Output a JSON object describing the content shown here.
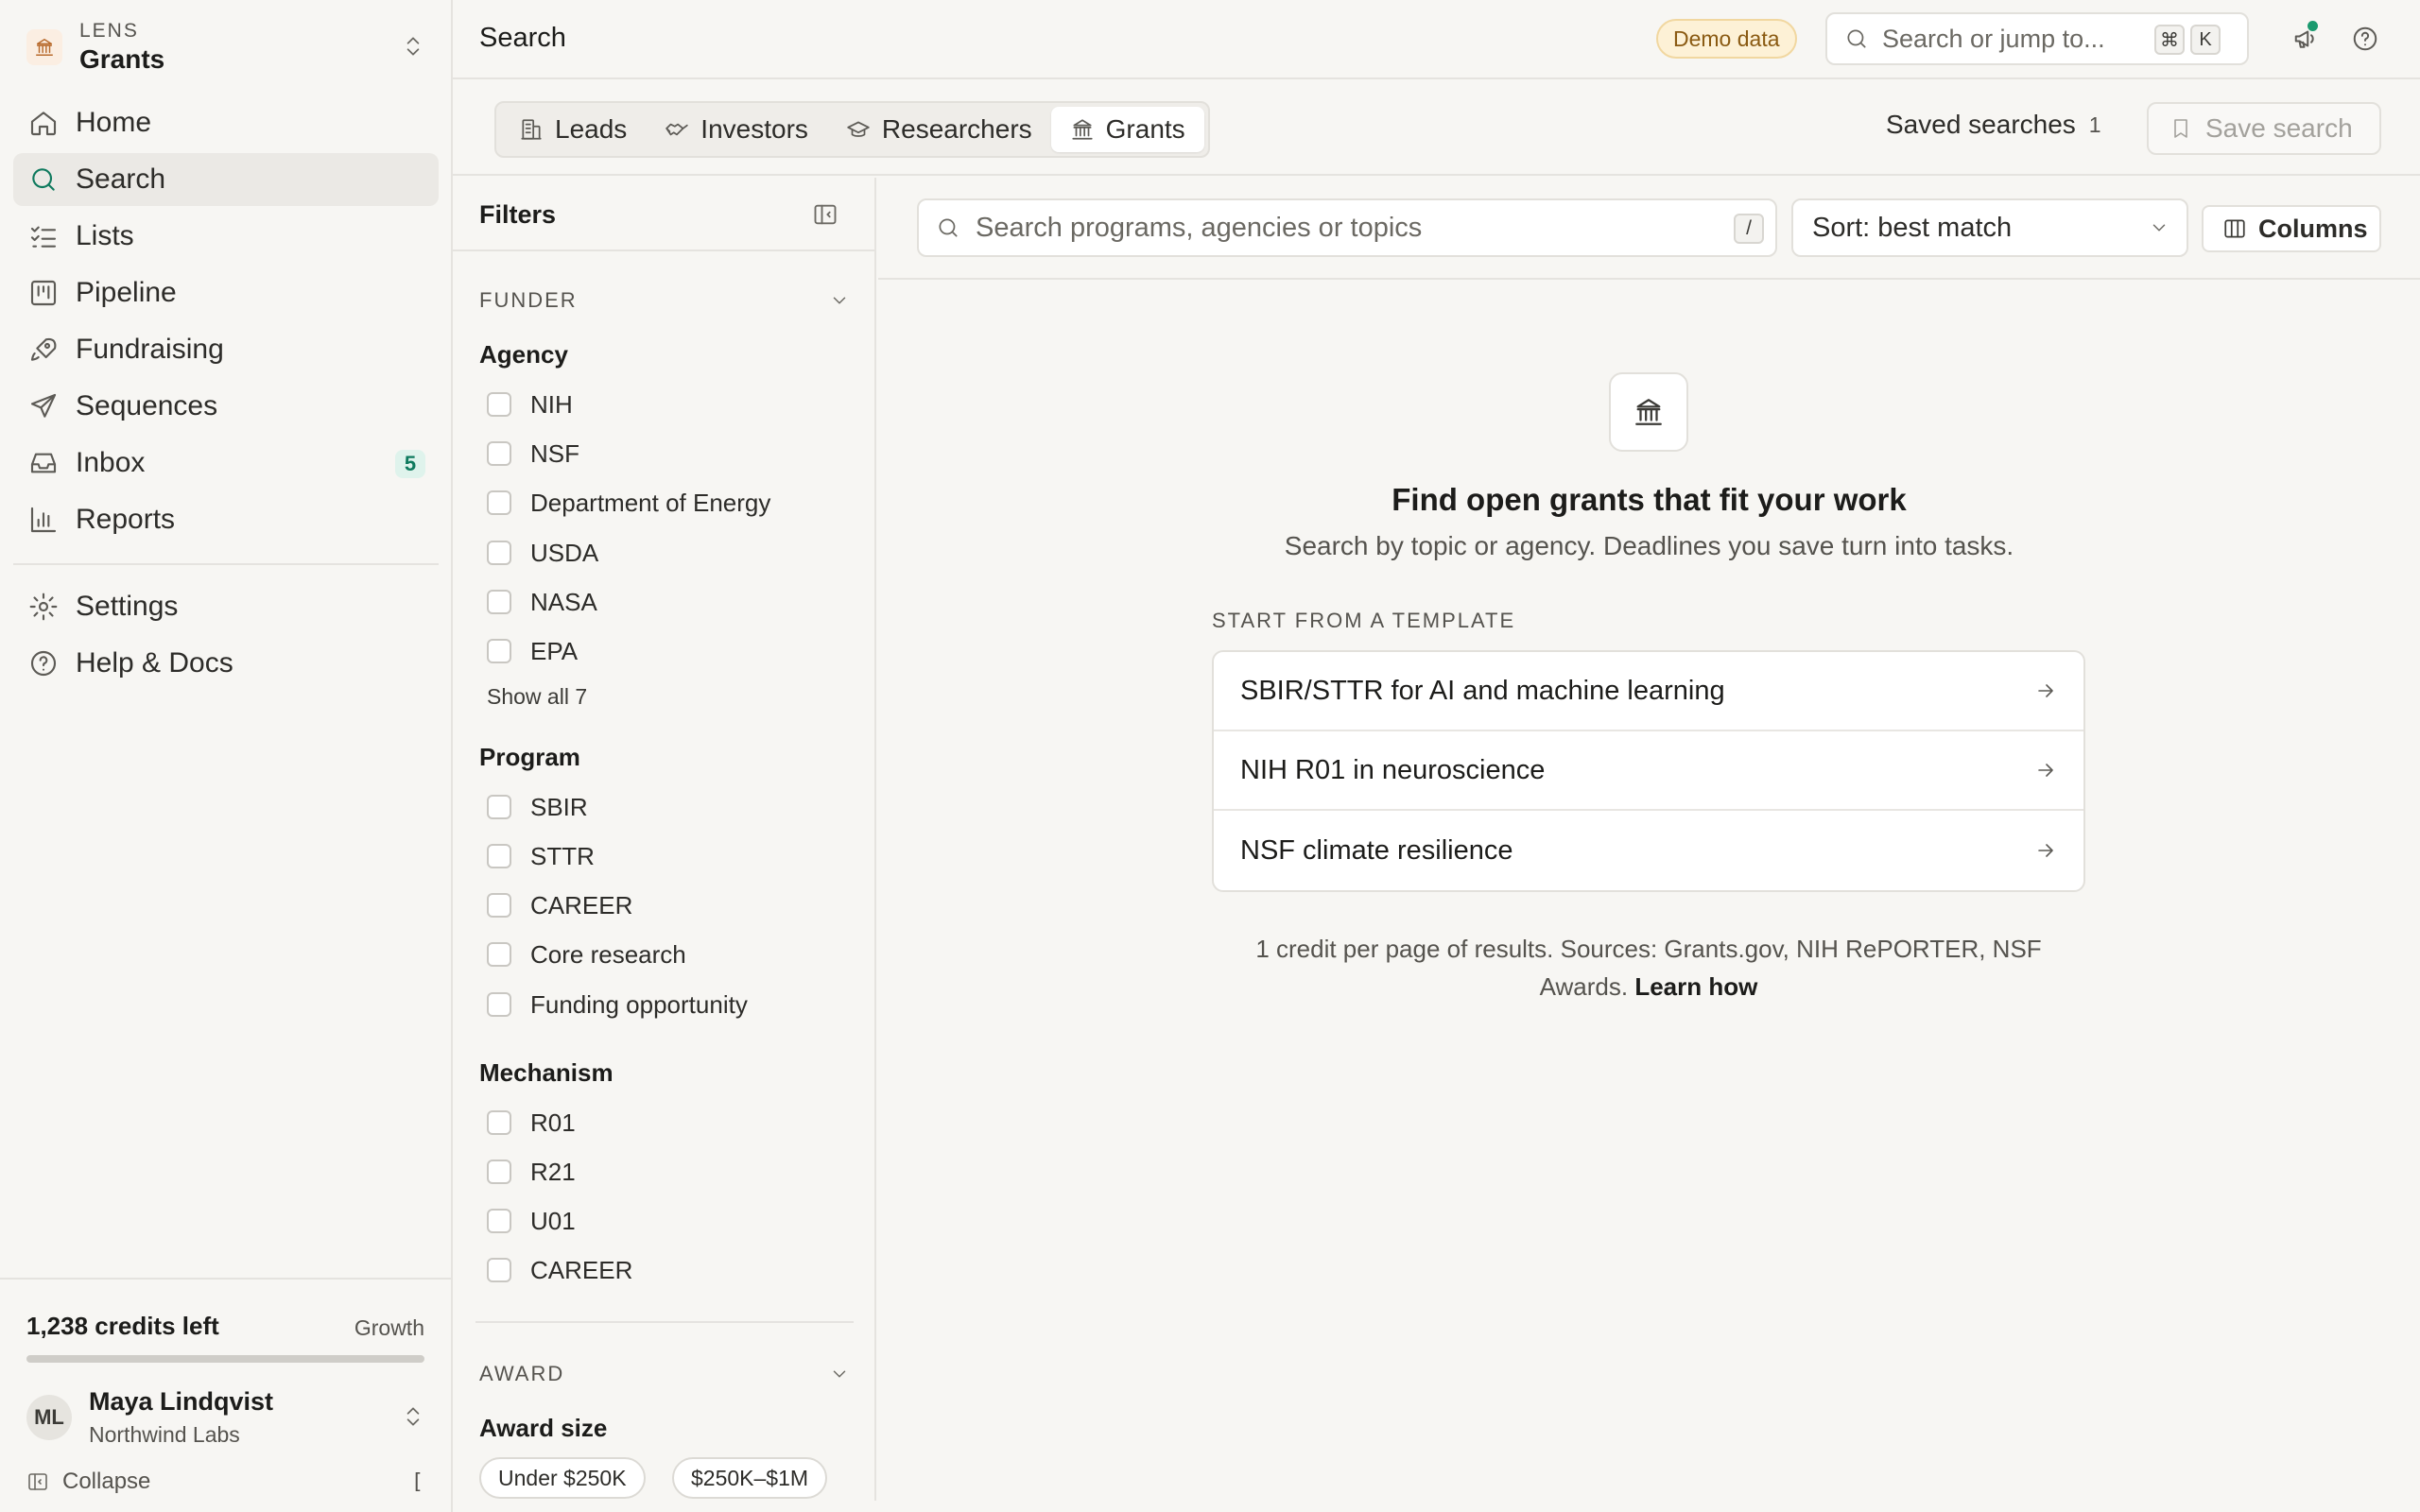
{
  "workspace": {
    "kicker": "LENS",
    "name": "Grants"
  },
  "nav": {
    "items": [
      {
        "label": "Home"
      },
      {
        "label": "Search"
      },
      {
        "label": "Lists"
      },
      {
        "label": "Pipeline"
      },
      {
        "label": "Fundraising"
      },
      {
        "label": "Sequences"
      },
      {
        "label": "Inbox",
        "badge": "5"
      },
      {
        "label": "Reports"
      }
    ],
    "secondary": [
      {
        "label": "Settings"
      },
      {
        "label": "Help & Docs"
      }
    ]
  },
  "sidebar_footer": {
    "credits": "1,238 credits left",
    "plan": "Growth",
    "credit_fraction_remaining": 1.0,
    "user_initials": "ML",
    "user_name": "Maya Lindqvist",
    "user_org": "Northwind Labs",
    "collapse_label": "Collapse",
    "collapse_shortcut": "["
  },
  "topbar": {
    "title": "Search",
    "demo_badge": "Demo data",
    "search_placeholder": "Search or jump to...",
    "shortcut_keys": [
      "⌘",
      "K"
    ]
  },
  "tabs": [
    {
      "label": "Leads",
      "icon": "building-icon"
    },
    {
      "label": "Investors",
      "icon": "handshake-icon"
    },
    {
      "label": "Researchers",
      "icon": "graduation-cap-icon"
    },
    {
      "label": "Grants",
      "icon": "landmark-icon"
    }
  ],
  "saved": {
    "label": "Saved searches",
    "count": "1",
    "save_button": "Save search"
  },
  "filters": {
    "title": "Filters",
    "funder_section": "FUNDER",
    "agency_label": "Agency",
    "agencies": [
      "NIH",
      "NSF",
      "Department of Energy",
      "USDA",
      "NASA",
      "EPA"
    ],
    "show_all": "Show all 7",
    "program_label": "Program",
    "programs": [
      "SBIR",
      "STTR",
      "CAREER",
      "Core research",
      "Funding opportunity"
    ],
    "mechanism_label": "Mechanism",
    "mechanisms": [
      "R01",
      "R21",
      "U01",
      "CAREER"
    ],
    "award_section": "AWARD",
    "award_size_label": "Award size",
    "award_sizes": [
      "Under $250K",
      "$250K–$1M"
    ]
  },
  "main": {
    "search_placeholder": "Search programs, agencies or topics",
    "search_shortcut": "/",
    "sort_label": "Sort: best match",
    "columns_label": "Columns",
    "empty_title": "Find open grants that fit your work",
    "empty_subtitle": "Search by topic or agency. Deadlines you save turn into tasks.",
    "template_label": "START FROM A TEMPLATE",
    "templates": [
      "SBIR/STTR for AI and machine learning",
      "NIH R01 in neuroscience",
      "NSF climate resilience"
    ],
    "footnote": "1 credit per page of results. Sources: Grants.gov, NIH RePORTER, NSF Awards.",
    "learn_link": "Learn how"
  },
  "colors": {
    "accent": "#0f7a5e",
    "background": "#f7f6f3",
    "demo_badge_bg": "#fdf1d6",
    "notification_dot": "#1a9a6e"
  }
}
